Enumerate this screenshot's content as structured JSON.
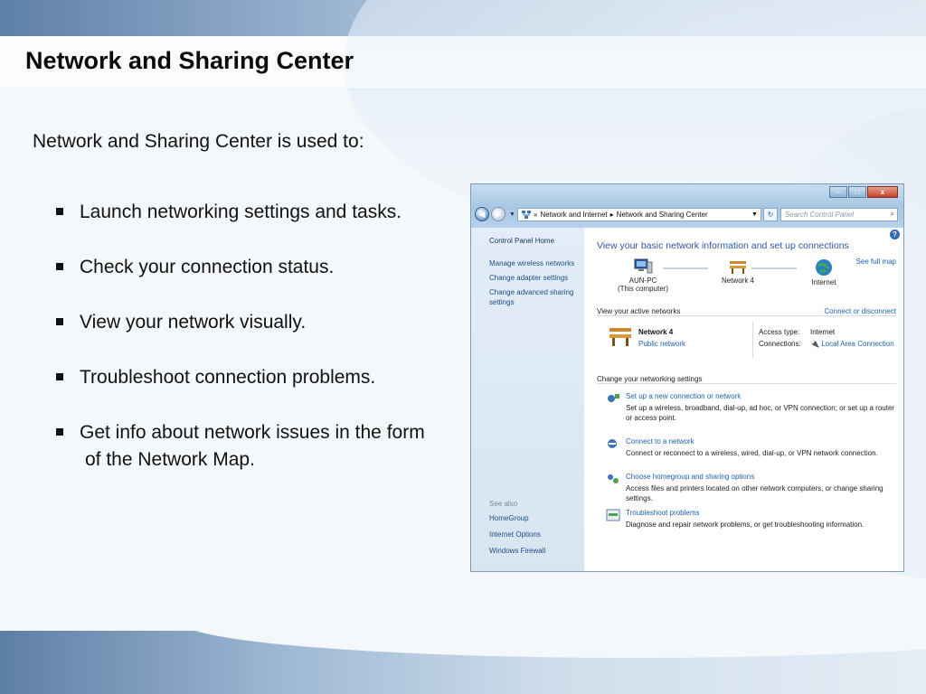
{
  "slide": {
    "title": "Network and Sharing Center",
    "intro": "Network and Sharing Center is used to:",
    "bullets": [
      "Launch networking settings and tasks.",
      "Check your connection status.",
      "View your network visually.",
      "Troubleshoot connection problems."
    ],
    "last_bullet_line1": "Get info about network issues in the form",
    "last_bullet_line2": "of the Network Map."
  },
  "window": {
    "breadcrumb": [
      "Network and Internet",
      "Network and Sharing Center"
    ],
    "search_placeholder": "Search Control Panel",
    "sidebar": {
      "home": "Control Panel Home",
      "links": [
        "Manage wireless networks",
        "Change adapter settings",
        "Change advanced sharing settings"
      ],
      "see_also_header": "See also",
      "see_also": [
        "HomeGroup",
        "Internet Options",
        "Windows Firewall"
      ]
    },
    "heading": "View your basic network information and set up connections",
    "see_full_map": "See full map",
    "map": {
      "pc_name": "AUN-PC",
      "pc_sub": "(This computer)",
      "network": "Network 4",
      "internet": "Internet"
    },
    "active_header": "View your active networks",
    "connect_disconnect": "Connect or disconnect",
    "active": {
      "name": "Network 4",
      "type": "Public network",
      "access_label": "Access type:",
      "access_value": "Internet",
      "conn_label": "Connections:",
      "conn_value": "Local Area Connection"
    },
    "change_header": "Change your networking settings",
    "tasks": [
      {
        "title": "Set up a new connection or network",
        "desc": "Set up a wireless, broadband, dial-up, ad hoc, or VPN connection; or set up a router or access point."
      },
      {
        "title": "Connect to a network",
        "desc": "Connect or reconnect to a wireless, wired, dial-up, or VPN network connection."
      },
      {
        "title": "Choose homegroup and sharing options",
        "desc": "Access files and printers located on other network computers, or change sharing settings."
      },
      {
        "title": "Troubleshoot problems",
        "desc": "Diagnose and repair network problems, or get troubleshooting information."
      }
    ],
    "icons": [
      "back-icon",
      "forward-icon",
      "network-icon",
      "refresh-icon",
      "search-icon",
      "help-icon",
      "computer-icon",
      "bench-icon",
      "globe-icon",
      "plug-icon"
    ]
  }
}
